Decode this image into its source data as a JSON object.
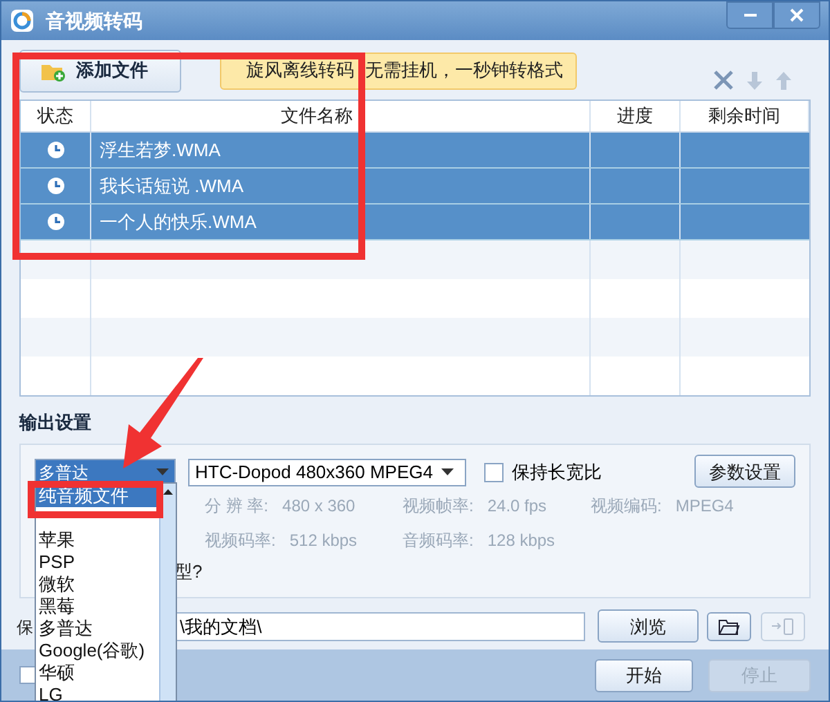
{
  "window": {
    "title": "音视频转码"
  },
  "toolbar": {
    "add_button": "添加文件",
    "banner": [
      "旋风离线转码",
      "无需挂机，一秒钟转格式"
    ]
  },
  "table": {
    "columns": [
      "状态",
      "文件名称",
      "进度",
      "剩余时间"
    ],
    "rows": [
      {
        "name": "浮生若梦.WMA",
        "selected": true
      },
      {
        "name": "我长话短说 .WMA",
        "selected": true
      },
      {
        "name": "一个人的快乐.WMA",
        "selected": true
      }
    ]
  },
  "output": {
    "title": "输出设置",
    "device_select": "多普达",
    "format_select": "HTC-Dopod 480x360 MPEG4",
    "keep_ratio": {
      "label": "保持长宽比",
      "checked": false
    },
    "params_button": "参数设置",
    "info": [
      [
        {
          "label": "分 辨 率:",
          "value": "480 x 360"
        },
        {
          "label": "视频帧率:",
          "value": "24.0 fps"
        },
        {
          "label": "视频编码:",
          "value": "MPEG4"
        }
      ],
      [
        {
          "label": "视频码率:",
          "value": "512 kbps"
        },
        {
          "label": "音频码率:",
          "value": "128 kbps"
        }
      ]
    ],
    "hint": "型?"
  },
  "save": {
    "label": "保",
    "path": "\\我的文档\\",
    "browse_button": "浏览"
  },
  "footer": {
    "checkbox": {
      "checked": false
    },
    "start_button": {
      "label": "开始",
      "disabled": false
    },
    "stop_button": {
      "label": "停止",
      "disabled": true
    }
  },
  "dropdown": {
    "items": [
      {
        "label": "纯音频文件",
        "selected": true
      },
      {
        "label": "苹果",
        "selected": false
      },
      {
        "label": "PSP",
        "selected": false
      },
      {
        "label": "微软",
        "selected": false
      },
      {
        "label": "黑莓",
        "selected": false
      },
      {
        "label": "多普达",
        "selected": false
      },
      {
        "label": "Google(谷歌)",
        "selected": false
      },
      {
        "label": "华硕",
        "selected": false
      },
      {
        "label": "LG",
        "selected": false
      }
    ]
  }
}
